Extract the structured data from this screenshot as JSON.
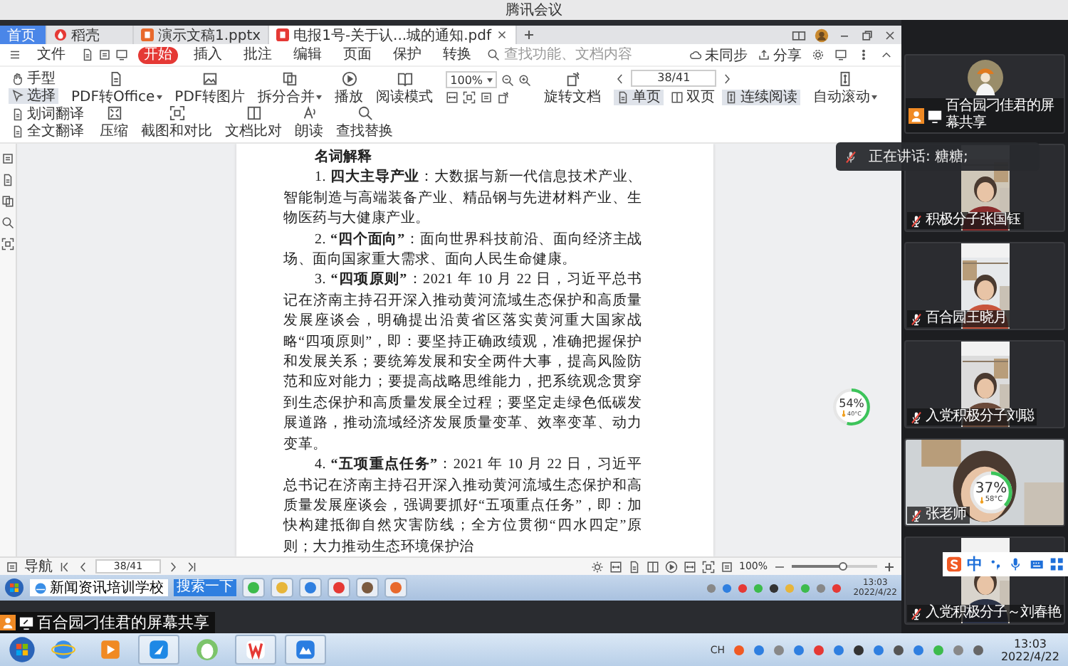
{
  "app_title": "腾讯会议",
  "shared_window": {
    "tabs": [
      {
        "label": "首页",
        "kind": "home",
        "selected": false
      },
      {
        "label": "稻壳",
        "kind": "shell",
        "selected": false
      },
      {
        "label": "演示文稿1.pptx",
        "kind": "slides",
        "selected": false
      },
      {
        "label": "电报1号-关于认...城的通知.pdf",
        "kind": "pdf",
        "selected": true
      }
    ],
    "menu": [
      {
        "label": "文件",
        "selected": false
      },
      {
        "label": "开始",
        "selected": true
      },
      {
        "label": "插入",
        "selected": false
      },
      {
        "label": "批注",
        "selected": false
      },
      {
        "label": "编辑",
        "selected": false
      },
      {
        "label": "页面",
        "selected": false
      },
      {
        "label": "保护",
        "selected": false
      },
      {
        "label": "转换",
        "selected": false
      }
    ],
    "search": {
      "placeholder": "查找功能、文档内容"
    },
    "sync_label": "未同步",
    "share_label": "分享",
    "toolbar": [
      {
        "kind": "pair",
        "items": [
          {
            "label": "手型",
            "selected": false
          },
          {
            "label": "选择",
            "selected": true
          }
        ]
      },
      {
        "kind": "tool",
        "label": "PDF转Office",
        "dropdown": true
      },
      {
        "kind": "tool",
        "label": "PDF转图片",
        "dropdown": false
      },
      {
        "kind": "tool",
        "label": "拆分合并",
        "dropdown": true
      },
      {
        "kind": "tool",
        "label": "播放",
        "dropdown": false
      },
      {
        "kind": "tool",
        "label": "阅读模式",
        "dropdown": false
      },
      {
        "kind": "zoom",
        "value": "100%"
      },
      {
        "kind": "tool",
        "label": "旋转文档",
        "dropdown": false
      },
      {
        "kind": "page",
        "value": "38/41",
        "views": [
          {
            "label": "单页",
            "selected": true
          },
          {
            "label": "双页",
            "selected": false
          },
          {
            "label": "连续阅读",
            "selected": true
          }
        ]
      },
      {
        "kind": "tool",
        "label": "自动滚动",
        "dropdown": true
      },
      {
        "kind": "pair",
        "items": [
          {
            "label": "划词翻译"
          },
          {
            "label": "全文翻译"
          }
        ]
      },
      {
        "kind": "tool",
        "label": "压缩",
        "dropdown": false
      },
      {
        "kind": "tool",
        "label": "截图和对比",
        "dropdown": false
      },
      {
        "kind": "tool",
        "label": "文档比对",
        "dropdown": false
      },
      {
        "kind": "tool",
        "label": "朗读",
        "dropdown": false
      },
      {
        "kind": "tool",
        "label": "查找替换",
        "dropdown": false
      }
    ],
    "document": {
      "heading": "名词解释",
      "paragraphs": [
        "1. **四大主导产业**：大数据与新一代信息技术产业、智能制造与高端装备产业、精品钢与先进材料产业、生物医药与大健康产业。",
        "2. **“四个面向”**：面向世界科技前沿、面向经济主战场、面向国家重大需求、面向人民生命健康。",
        "3. **“四项原则”**：2021 年 10 月 22 日，习近平总书记在济南主持召开深入推动黄河流域生态保护和高质量发展座谈会，明确提出沿黄省区落实黄河重大国家战略“四项原则”，即：要坚持正确政绩观，准确把握保护和发展关系；要统筹发展和安全两件大事，提高风险防范和应对能力；要提高战略思维能力，把系统观念贯穿到生态保护和高质量发展全过程；要坚定走绿色低碳发展道路，推动流域经济发展质量变革、效率变革、动力变革。",
        "4. **“五项重点任务”**：2021 年 10 月 22 日，习近平总书记在济南主持召开深入推动黄河流域生态保护和高质量发展座谈会，强调要抓好“五项重点任务”，即：加快构建抵御自然灾害防线；全方位贯彻“四水四定”原则；大力推动生态环境保护治"
      ]
    },
    "status_bar": {
      "nav_label": "导航",
      "page": "38/41",
      "zoom": "100%",
      "zoom_slider": {
        "level": 0.6
      }
    },
    "gauge": {
      "percent": "54%",
      "temperature": "40°C",
      "level": 0.54
    },
    "taskbar": {
      "browser_label": "新闻资讯培训学校",
      "search_label": "搜索一下",
      "time": "13:03",
      "date": "2022/4/22"
    }
  },
  "share_banner": "百合园刁佳君的屏幕共享",
  "speaking_toast": "正在讲话: 糖糖;",
  "participants": [
    {
      "kind": "share",
      "name": "百合园刁佳君的屏幕共享"
    },
    {
      "kind": "portrait_video",
      "name": "积极分子张国钰",
      "muted": true
    },
    {
      "kind": "portrait_video",
      "name": "百合园王晓月",
      "muted": true
    },
    {
      "kind": "portrait_video",
      "name": "入党积极分子刘聪",
      "muted": true
    },
    {
      "kind": "video",
      "name": "张老师",
      "muted": true
    },
    {
      "kind": "portrait_video",
      "name": "入党积极分子～刘春艳",
      "muted": true
    }
  ],
  "panel_gauge": {
    "percent": "37%",
    "temperature": "58°C",
    "level": 0.37
  },
  "ime_bar": {
    "mode": "中"
  },
  "taskbar": {
    "language": "CH",
    "time": "13:03",
    "date": "2022/4/22"
  }
}
